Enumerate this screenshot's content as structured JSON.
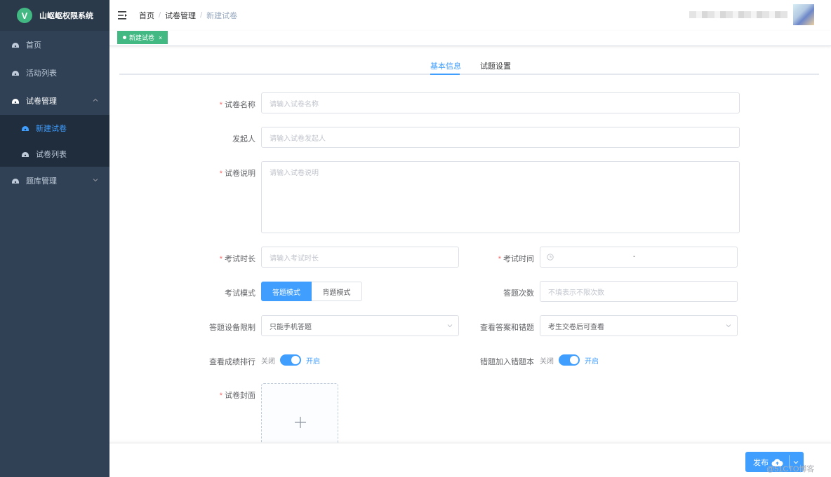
{
  "app": {
    "title": "山岖岖权限系统",
    "logo_letter": "V"
  },
  "sidebar": {
    "items": [
      {
        "label": "首页",
        "icon": "dashboard-icon"
      },
      {
        "label": "活动列表",
        "icon": "dashboard-icon"
      },
      {
        "label": "试卷管理",
        "icon": "dashboard-icon",
        "expanded": true,
        "children": [
          {
            "label": "新建试卷",
            "active": true
          },
          {
            "label": "试卷列表"
          }
        ]
      },
      {
        "label": "题库管理",
        "icon": "dashboard-icon",
        "expanded": false
      }
    ]
  },
  "header": {
    "breadcrumb": [
      "首页",
      "试卷管理",
      "新建试卷"
    ],
    "tag_label": "新建试卷",
    "tag_close": "×"
  },
  "tabs": [
    {
      "label": "基本信息",
      "active": true
    },
    {
      "label": "试题设置",
      "active": false
    }
  ],
  "form": {
    "name": {
      "label": "试卷名称",
      "placeholder": "请输入试卷名称",
      "required": true
    },
    "initiator": {
      "label": "发起人",
      "placeholder": "请输入试卷发起人"
    },
    "description": {
      "label": "试卷说明",
      "placeholder": "请输入试卷说明",
      "required": true
    },
    "duration": {
      "label": "考试时长",
      "placeholder": "请输入考试时长",
      "required": true
    },
    "exam_time": {
      "label": "考试时间",
      "range_separator": "-",
      "required": true
    },
    "mode": {
      "label": "考试模式",
      "options": [
        "答题模式",
        "背题模式"
      ],
      "selected": "答题模式"
    },
    "attempts": {
      "label": "答题次数",
      "placeholder": "不填表示不限次数"
    },
    "device": {
      "label": "答题设备限制",
      "value": "只能手机答题"
    },
    "view_answers": {
      "label": "查看答案和错题",
      "value": "考生交卷后可查看"
    },
    "ranking": {
      "label": "查看成绩排行",
      "off_text": "关闭",
      "on_text": "开启",
      "on": true
    },
    "wrong_book": {
      "label": "错题加入错题本",
      "off_text": "关闭",
      "on_text": "开启",
      "on": true
    },
    "cover": {
      "label": "试卷封面",
      "required": true
    }
  },
  "footer": {
    "publish_label": "发布",
    "watermark": "@51CTO博客"
  },
  "colors": {
    "primary": "#409eff",
    "sidebar": "#304156",
    "tag": "#42b983",
    "required": "#f56c6c"
  }
}
